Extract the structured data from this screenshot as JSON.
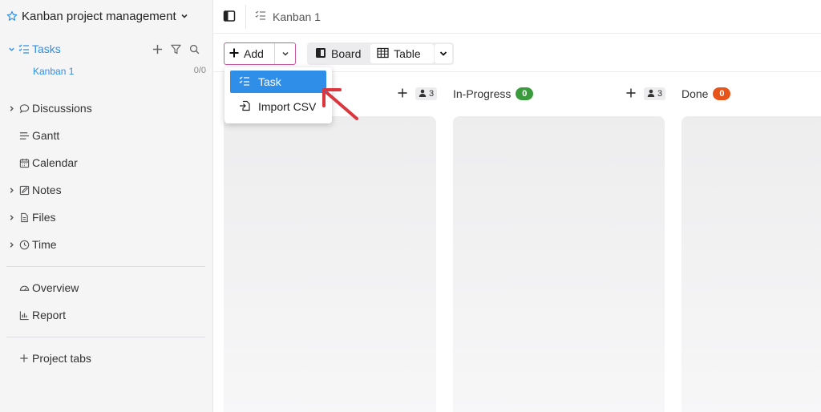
{
  "sidebar": {
    "project_title": "Kanban project management",
    "tasks_label": "Tasks",
    "kanban_label": "Kanban 1",
    "kanban_count": "0/0",
    "items": [
      {
        "label": "Discussions",
        "icon": "chat-icon"
      },
      {
        "label": "Gantt",
        "icon": "gantt-icon"
      },
      {
        "label": "Calendar",
        "icon": "calendar-icon"
      },
      {
        "label": "Notes",
        "icon": "notes-icon"
      },
      {
        "label": "Files",
        "icon": "file-icon"
      },
      {
        "label": "Time",
        "icon": "clock-icon"
      },
      {
        "label": "Overview",
        "icon": "gauge-icon"
      },
      {
        "label": "Report",
        "icon": "bar-chart-icon"
      },
      {
        "label": "Project tabs",
        "icon": "plus-icon"
      }
    ]
  },
  "header": {
    "breadcrumb": "Kanban 1"
  },
  "toolbar": {
    "add_label": "Add",
    "board_label": "Board",
    "table_label": "Table"
  },
  "dropdown": {
    "items": [
      "Task",
      "Import CSV"
    ]
  },
  "board": {
    "columns": [
      {
        "name": "",
        "count": "",
        "assignees": "3"
      },
      {
        "name": "In-Progress",
        "count": "0",
        "count_color": "#3a9b3c",
        "assignees": "3"
      },
      {
        "name": "Done",
        "count": "0",
        "count_color": "#e8531a"
      }
    ]
  },
  "colors": {
    "accent": "#2f8ee8",
    "add_border": "#c9599c",
    "annotation": "#d9363e"
  }
}
